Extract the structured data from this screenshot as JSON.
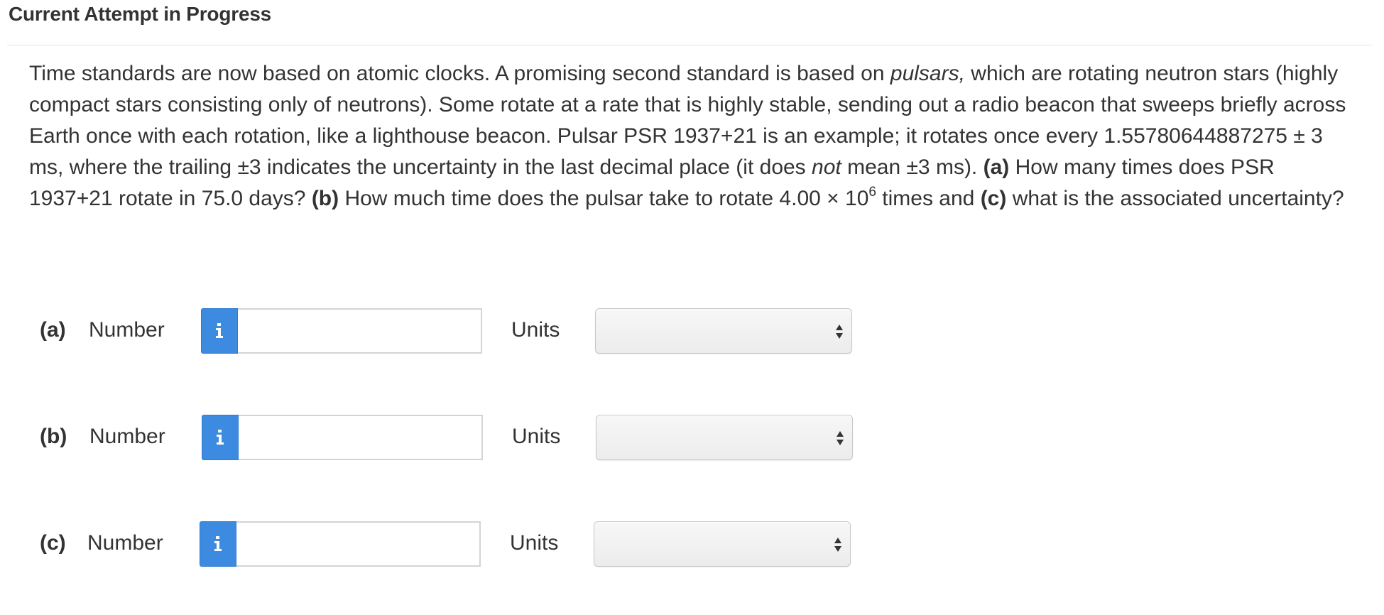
{
  "header": {
    "title": "Current Attempt in Progress"
  },
  "question": {
    "s1": "Time standards are now based on atomic clocks. A promising second standard is based on ",
    "s1_italic": "pulsars,",
    "s2": " which are rotating neutron stars (highly compact stars consisting only of neutrons). Some rotate at a rate that is highly stable, sending out a radio beacon that sweeps briefly across Earth once with each rotation, like a lighthouse beacon. Pulsar PSR 1937+21 is an example; it rotates once every 1.55780644887275 ± 3 ms, where the trailing ±3 indicates the uncertainty in the last decimal place (it does ",
    "s2_italic": "not",
    "s3": " mean ±3 ms). ",
    "a_label": "(a)",
    "a_text": " How many times does PSR 1937+21 rotate in 75.0 days? ",
    "b_label": "(b)",
    "b_text": " How much time does the pulsar take to rotate 4.00 × 10",
    "b_exp": "6",
    "b_text2": " times and ",
    "c_label": "(c)",
    "c_text": " what is the associated uncertainty?"
  },
  "answers": [
    {
      "letter": "(a)",
      "number_label": "Number",
      "info_icon": "info-icon",
      "number_value": "",
      "units_label": "Units",
      "units_selected": ""
    },
    {
      "letter": "(b)",
      "number_label": "Number",
      "info_icon": "info-icon",
      "number_value": "",
      "units_label": "Units",
      "units_selected": ""
    },
    {
      "letter": "(c)",
      "number_label": "Number",
      "info_icon": "info-icon",
      "number_value": "",
      "units_label": "Units",
      "units_selected": ""
    }
  ],
  "colors": {
    "info_button": "#3d8be0",
    "text": "#333333",
    "divider": "#e6e6e6"
  }
}
